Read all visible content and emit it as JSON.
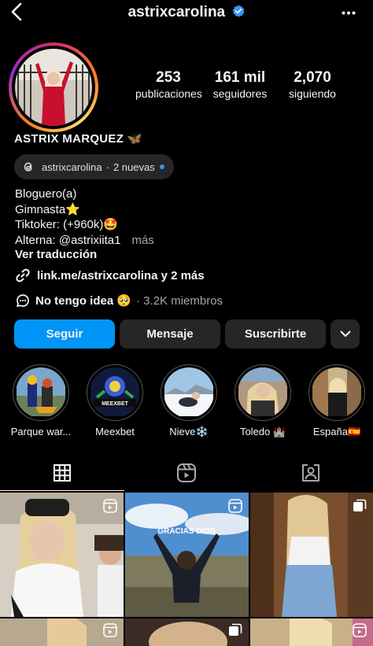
{
  "header": {
    "username": "astrixcarolina"
  },
  "profile": {
    "stats": [
      {
        "value": "253",
        "label": "publicaciones"
      },
      {
        "value": "161 mil",
        "label": "seguidores"
      },
      {
        "value": "2,070",
        "label": "siguiendo"
      }
    ],
    "full_name": "ASTRIX MARQUEZ",
    "name_emoji": "🦋",
    "threads": {
      "handle": "astrixcarolina",
      "separator": "·",
      "new_label": "2 nuevas"
    },
    "bio": {
      "line1": "Bloguero(a)",
      "line2": "Gimnasta⭐",
      "line3": "Tiktoker: (+960k)🤩",
      "line4": "Alterna: @astrixiita1",
      "more": "más"
    },
    "translate_label": "Ver traducción",
    "link": "link.me/astrixcarolina y 2 más",
    "channel": {
      "name": "No tengo idea 🥺",
      "members": "· 3.2K miembros"
    }
  },
  "actions": {
    "follow": "Seguir",
    "message": "Mensaje",
    "subscribe": "Suscribirte"
  },
  "highlights": [
    {
      "label": "Parque war..."
    },
    {
      "label": "Meexbet"
    },
    {
      "label": "Nieve❄️"
    },
    {
      "label": "Toledo 🏰"
    },
    {
      "label": "España🇪🇸"
    }
  ],
  "grid": {
    "tile2_caption": "GRACIAS DIOS",
    "meexbet_text": "MEEXBET"
  },
  "colors": {
    "accent": "#0095f6",
    "button_bg": "#262626",
    "background": "#000000",
    "verified": "#3897f0"
  }
}
